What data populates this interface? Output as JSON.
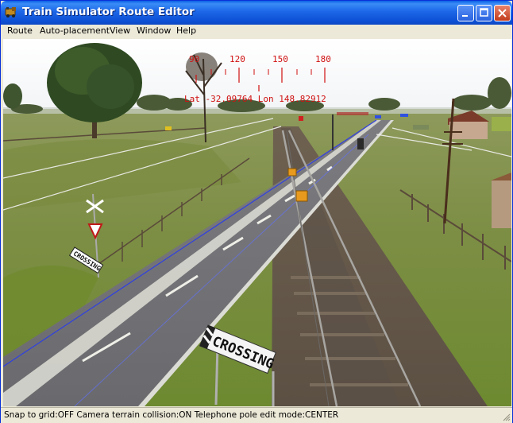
{
  "window": {
    "title": "Train Simulator Route Editor"
  },
  "menu": {
    "route": "Route",
    "auto_placement": "Auto-placement",
    "view": "View",
    "window": "Window",
    "help": "Help"
  },
  "compass": {
    "ticks": [
      "90",
      "120",
      "150",
      "180"
    ],
    "coordinates": "Lat -32.09764 Lon 148.82912"
  },
  "scene": {
    "crossing_sign": "CROSSING",
    "small_sign": "CROSSING"
  },
  "status": {
    "text": "Snap to grid:OFF Camera terrain collision:ON Telephone pole edit mode:CENTER"
  },
  "colors": {
    "title_bar": "#0d50d5",
    "compass_red": "#d01010",
    "close_button": "#c23b1c"
  }
}
